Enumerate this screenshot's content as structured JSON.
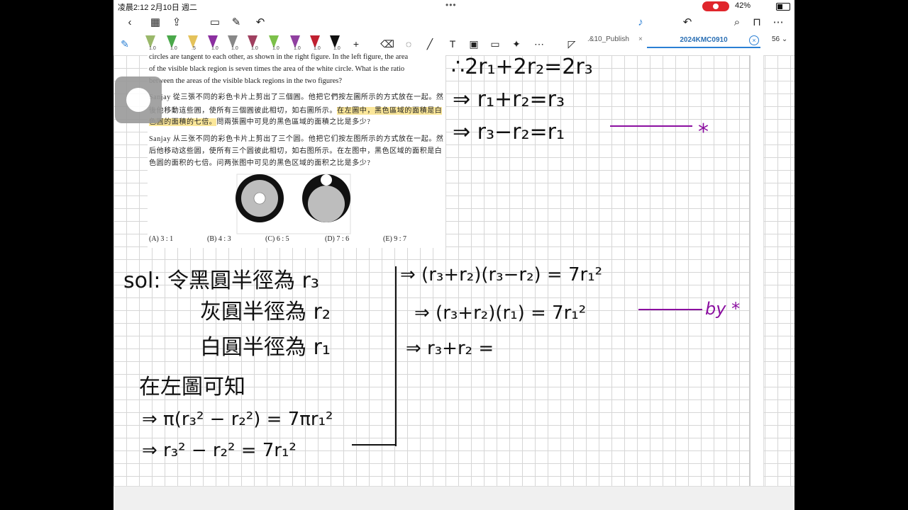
{
  "status_bar": {
    "time_date": "凌晨2:12   2月10日 週二",
    "battery": "42%"
  },
  "tabs": {
    "tab1_label": ".&10_Publish",
    "tab2_label": "2024KMC0910",
    "page_count": "56"
  },
  "problem": {
    "en_line1": "circles are tangent to each other, as shown in the right figure. In the left figure, the area",
    "en_line2": "of the visible black region is seven times the area of the white circle. What is the ratio",
    "en_line3": "between the areas of the visible black regions in the two figures?",
    "zh_trad_1": "Sanjay 從三張不同的彩色卡片上剪出了三個圓。他把它們按左圖所示的方式放在一起。然",
    "zh_trad_2a": "後他移動這些圓，使所有三個圓彼此相切，如右圖所示。",
    "zh_trad_2b": "在左圖中，黑色區域的面積是白",
    "zh_trad_3a": "色圓的面積的七倍。",
    "zh_trad_3b": "問兩張圖中可見的黑色區域的面積之比是多少?",
    "zh_simp_1": "Sanjay 从三张不同的彩色卡片上剪出了三个圆。他把它们按左图所示的方式放在一起。然",
    "zh_simp_2": "后他移动这些圆，使所有三个圆彼此相切，如右图所示。在左图中，黑色区域的面积是白",
    "zh_simp_3": "色圆的面积的七倍。问两张图中可见的黑色区域的面积之比是多少?",
    "choices": [
      "(A) 3 : 1",
      "(B) 4 : 3",
      "(C) 6 : 5",
      "(D) 7 : 6",
      "(E) 9 : 7"
    ]
  },
  "handwriting": {
    "line_a": "∴2r₁+2r₂=2r₃",
    "line_b": "⇒ r₁+r₂=r₃",
    "line_c": "⇒ r₃−r₂=r₁",
    "mark_star": "*",
    "sol_1": "sol: 令黑圓半徑為 r₃",
    "sol_2": "灰圓半徑為 r₂",
    "sol_3": "白圓半徑為 r₁",
    "sol_4": "在左圖可知",
    "sol_5": "⇒ π(r₃² − r₂²) = 7πr₁²",
    "sol_6": "⇒ r₃² − r₂² = 7r₁²",
    "mid_1": "⇒ (r₃+r₂)(r₃−r₂) = 7r₁²",
    "mid_2": "⇒ (r₃+r₂)(r₁) = 7r₁²",
    "mid_3": "⇒ r₃+r₂ =",
    "by_star": "by *"
  }
}
